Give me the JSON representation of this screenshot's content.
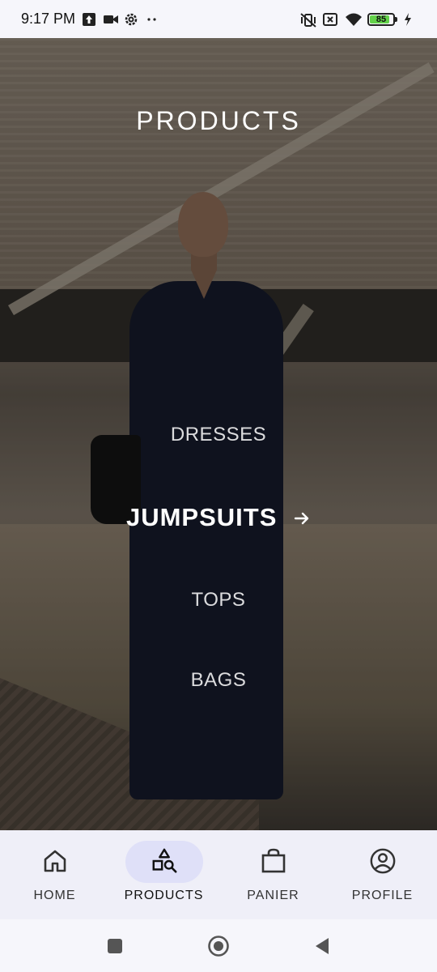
{
  "status_bar": {
    "time": "9:17 PM",
    "battery_percent": "85"
  },
  "page": {
    "title": "PRODUCTS"
  },
  "categories": [
    {
      "label": "DRESSES",
      "active": false
    },
    {
      "label": "JUMPSUITS",
      "active": true
    },
    {
      "label": "TOPS",
      "active": false
    },
    {
      "label": "BAGS",
      "active": false
    }
  ],
  "bottom_nav": {
    "items": [
      {
        "label": "HOME",
        "icon": "home-icon",
        "active": false
      },
      {
        "label": "PRODUCTS",
        "icon": "shapes-search-icon",
        "active": true
      },
      {
        "label": "PANIER",
        "icon": "shopping-bag-icon",
        "active": false
      },
      {
        "label": "PROFILE",
        "icon": "account-circle-icon",
        "active": false
      }
    ]
  },
  "colors": {
    "nav_background": "#efeff8",
    "nav_active_pill": "#dfe0f8",
    "battery_fill": "#63d14a"
  }
}
